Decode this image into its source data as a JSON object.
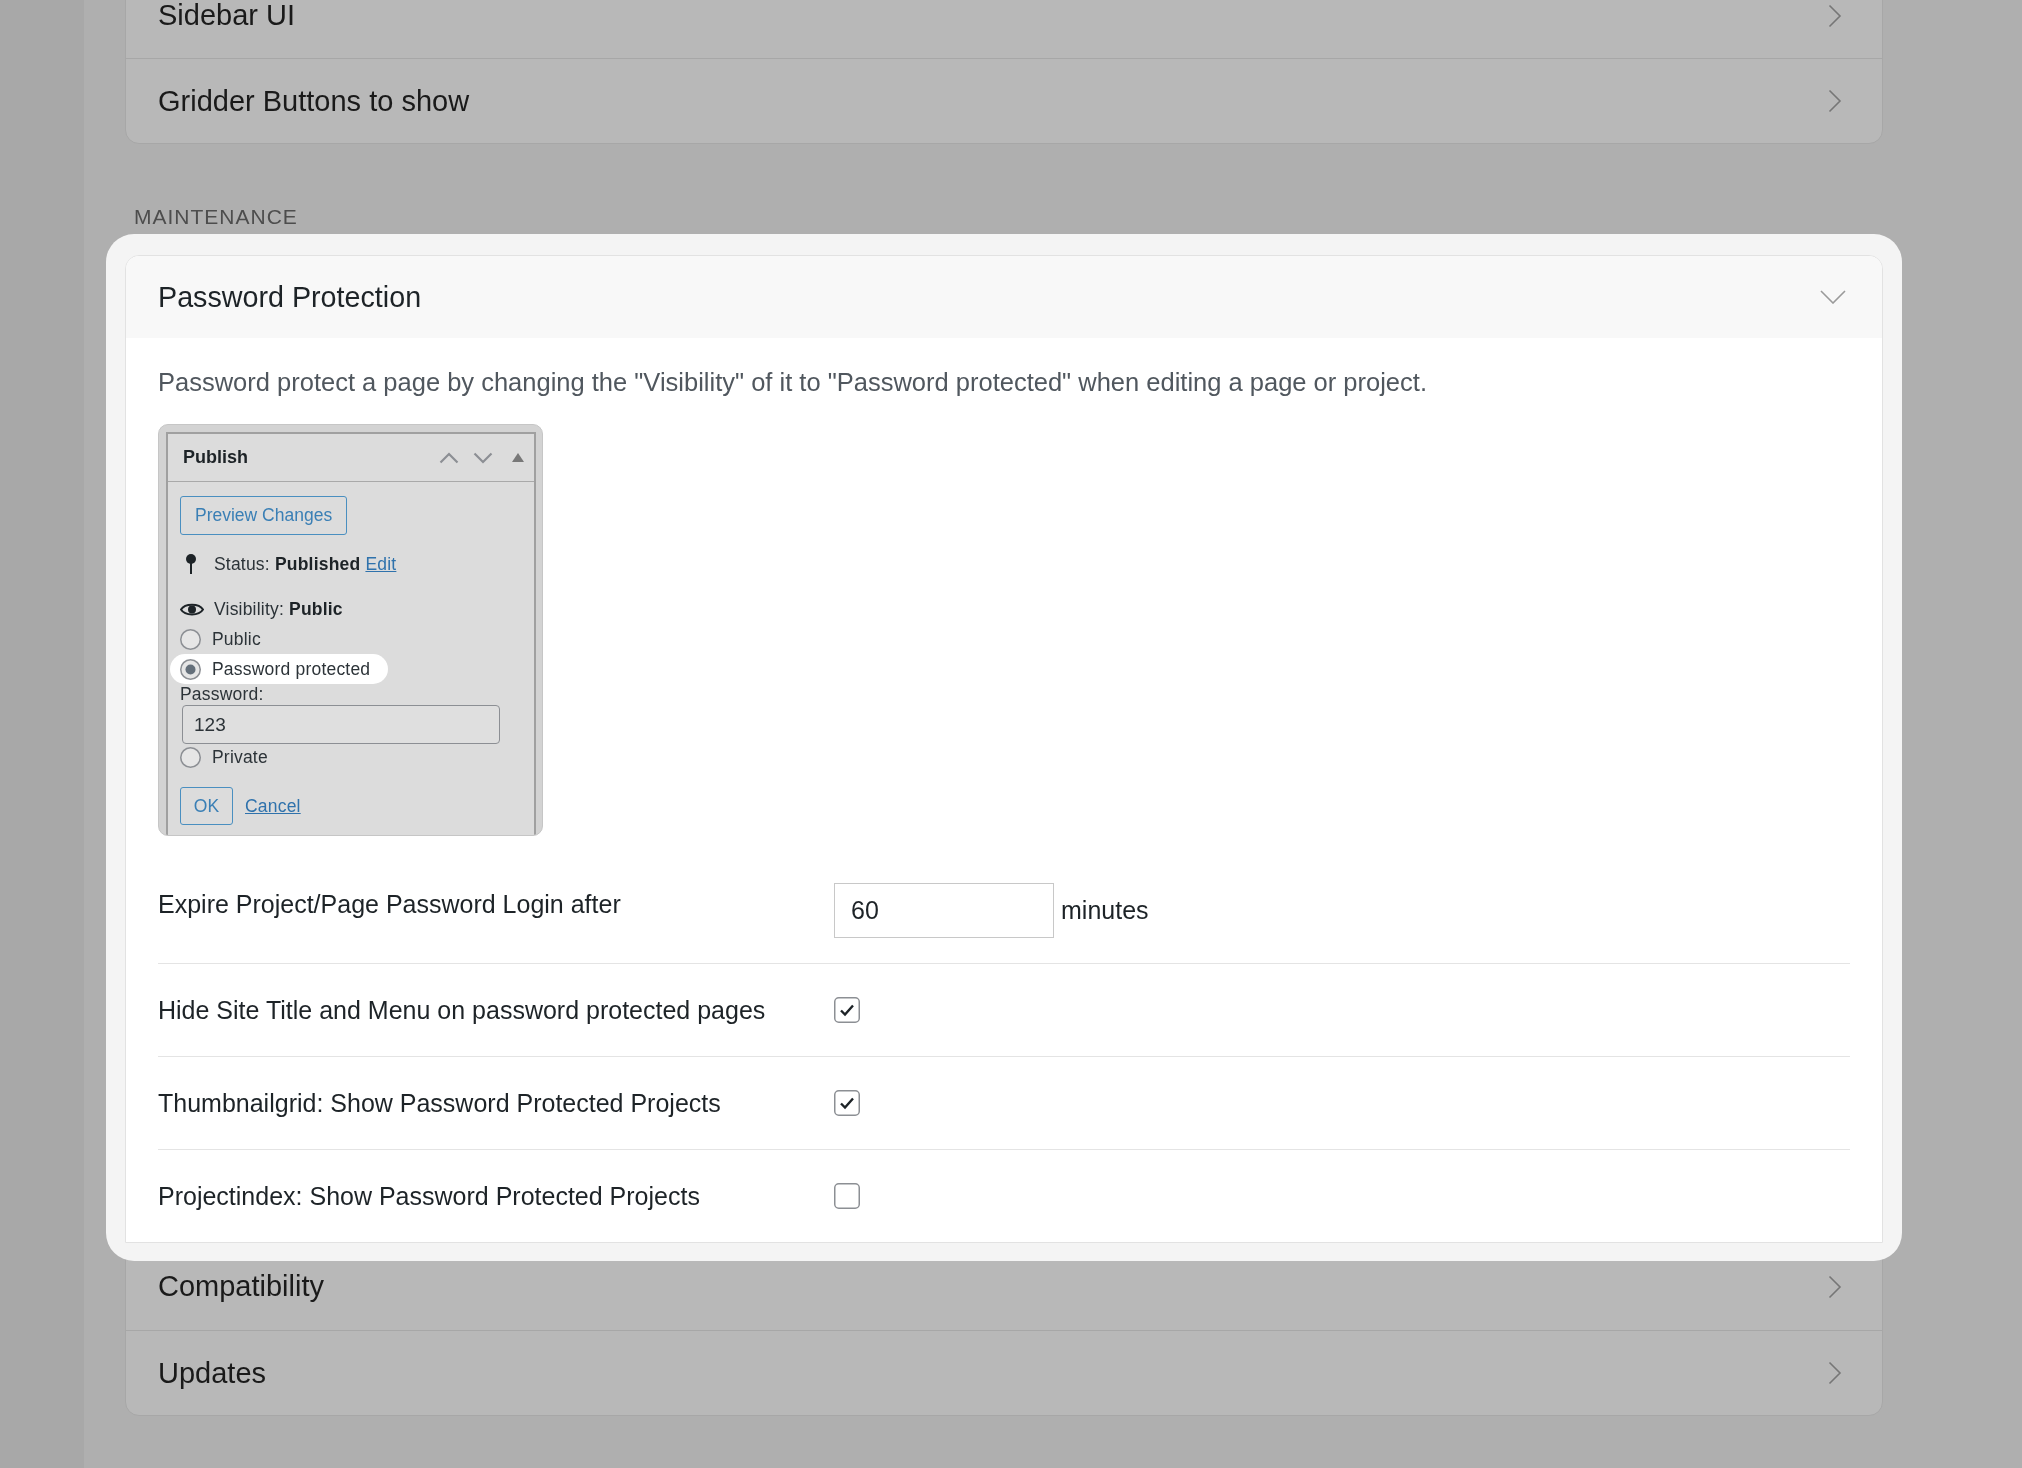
{
  "top_card": {
    "items": [
      {
        "label": "Sidebar UI",
        "expanded": false,
        "highlighted": false
      },
      {
        "label": "Gridder Buttons to show",
        "expanded": false,
        "highlighted": false
      }
    ]
  },
  "section_heading": "MAINTENANCE",
  "maintenance_card": {
    "items": [
      {
        "label": "Password Protection",
        "expanded": true,
        "highlighted": true,
        "description": "Password protect a page by changing the \"Visibility\" of it to \"Password protected\" when editing a page or project.",
        "publish_box": {
          "title": "Publish",
          "preview_button": "Preview Changes",
          "status": "Status: **Published**",
          "status_link": "Edit",
          "visibility": "Visibility: **Public**",
          "options": [
            {
              "label": "Public",
              "selected": false,
              "highlighted": false
            },
            {
              "label": "Password protected",
              "selected": true,
              "highlighted": true,
              "password_field": {
                "label": "Password:",
                "value": "123"
              }
            },
            {
              "label": "Private",
              "selected": false,
              "highlighted": false
            }
          ],
          "ok_button": "OK",
          "cancel_link": "Cancel"
        },
        "settings": [
          {
            "kind": "number",
            "label": "Expire Project/Page Password Login after",
            "value": "60",
            "unit": "minutes"
          },
          {
            "kind": "checkbox",
            "label": "Hide Site Title and Menu on password protected pages",
            "checked": true
          },
          {
            "kind": "checkbox",
            "label": "Thumbnailgrid: Show Password Protected Projects",
            "checked": true
          },
          {
            "kind": "checkbox",
            "label": "Projectindex: Show Password Protected Projects",
            "checked": false
          }
        ]
      },
      {
        "label": "Compatibility",
        "expanded": false,
        "highlighted": false
      },
      {
        "label": "Updates",
        "expanded": false,
        "highlighted": false
      }
    ]
  }
}
